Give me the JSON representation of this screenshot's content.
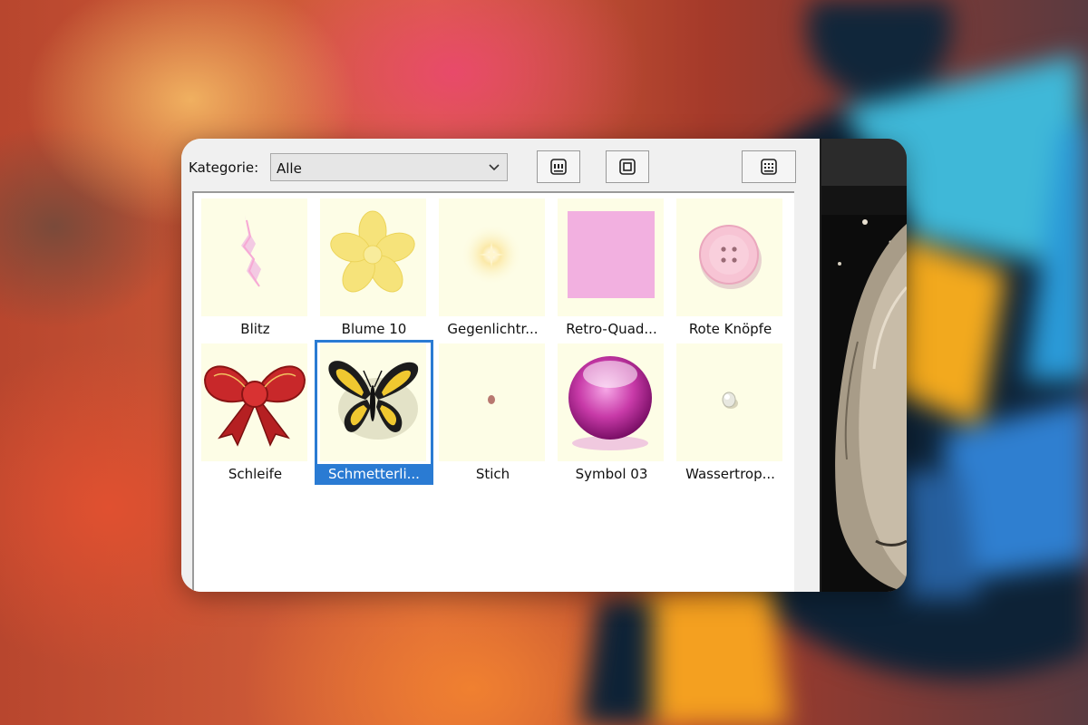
{
  "toolbar": {
    "category_label": "Kategorie:",
    "category_value": "Alle"
  },
  "items": [
    {
      "label": "Blitz",
      "icon": "lightning-icon"
    },
    {
      "label": "Blume 10",
      "icon": "flower-icon"
    },
    {
      "label": "Gegenlichtr...",
      "icon": "lens-flare-icon"
    },
    {
      "label": "Retro-Quad...",
      "icon": "pink-square-icon"
    },
    {
      "label": "Rote Knöpfe",
      "icon": "button-icon"
    },
    {
      "label": "Schleife",
      "icon": "bow-icon"
    },
    {
      "label": "Schmetterli...",
      "icon": "butterfly-icon",
      "selected": true
    },
    {
      "label": "Stich",
      "icon": "stitch-icon"
    },
    {
      "label": "Symbol 03",
      "icon": "glass-sphere-icon"
    },
    {
      "label": "Wassertrop...",
      "icon": "water-drop-icon"
    }
  ],
  "colors": {
    "selection": "#2a7bd3",
    "thumbnail_bg": "#fdfde6"
  }
}
